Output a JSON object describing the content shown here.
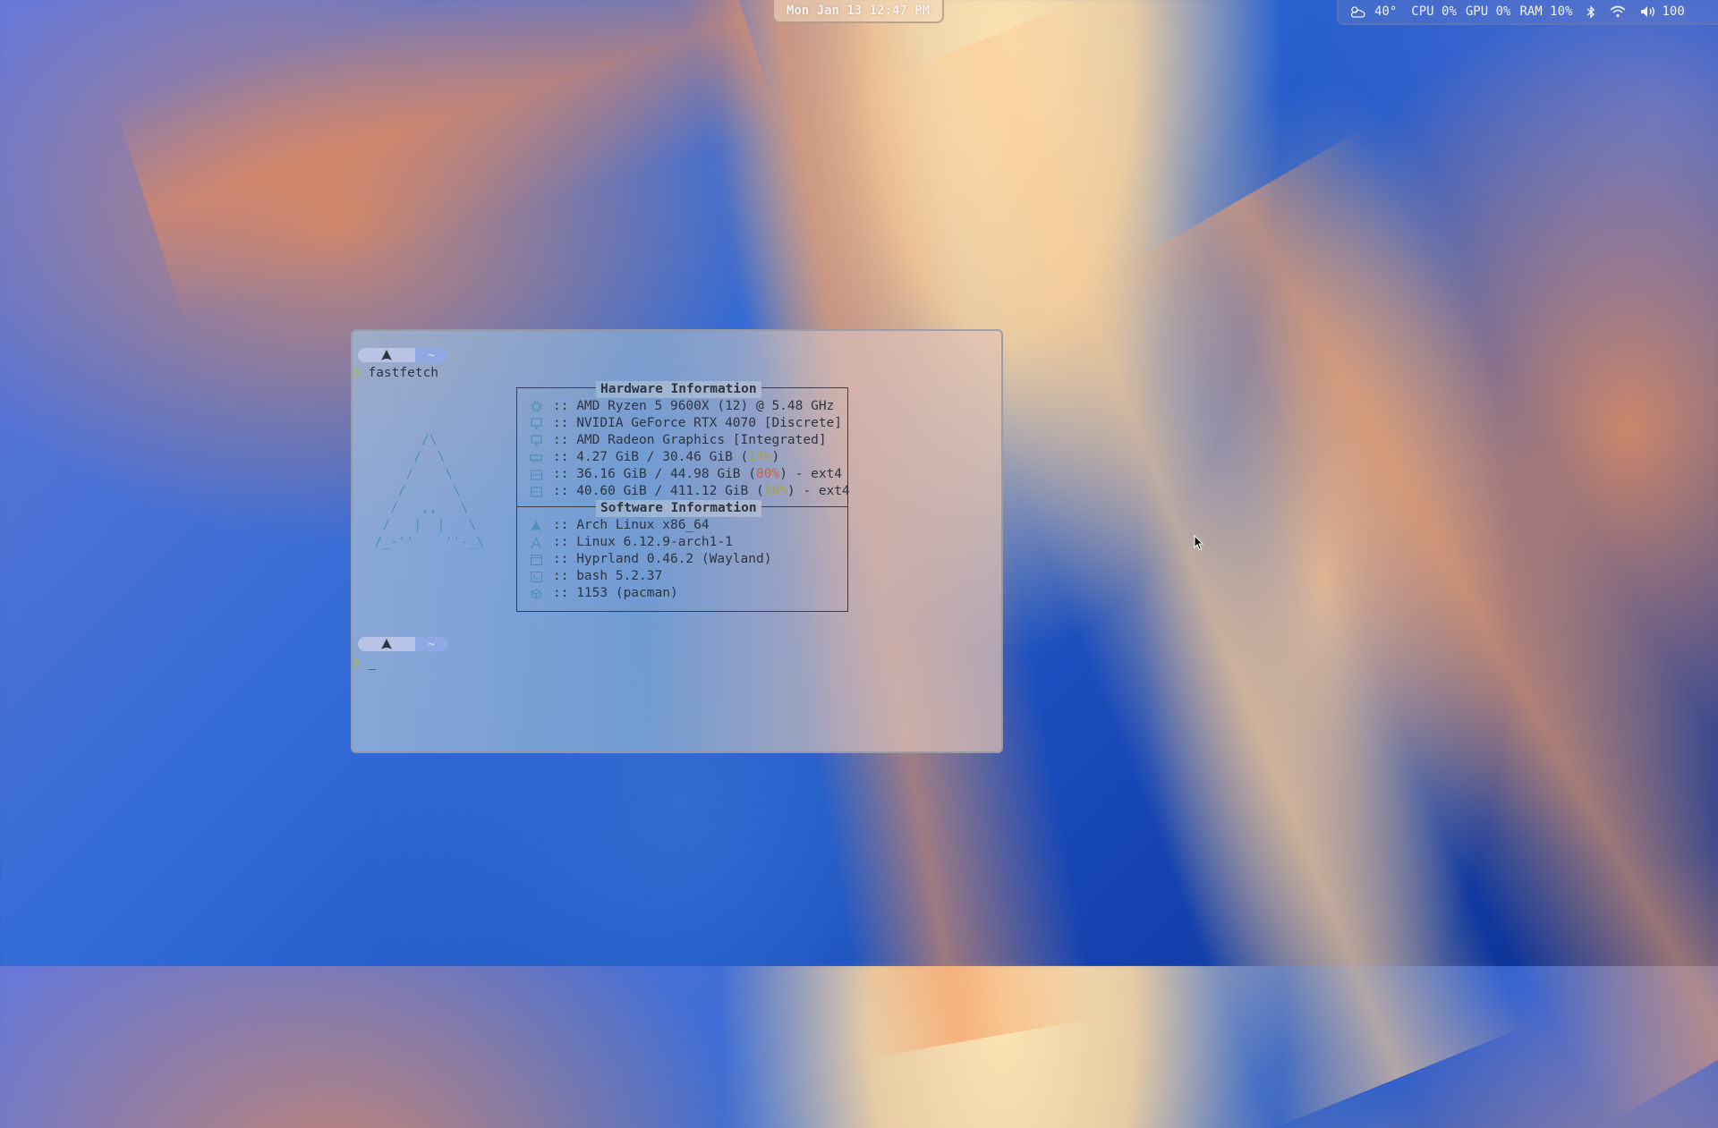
{
  "topbar": {
    "clock": "Mon Jan 13 12:47 PM",
    "weather": "40°",
    "cpu": "CPU 0%",
    "gpu": "GPU 0%",
    "ram": "RAM 10%",
    "volume": "100",
    "icons": [
      "weather-cloud-sun-icon",
      "bluetooth-icon",
      "wifi-icon",
      "volume-icon"
    ]
  },
  "terminal": {
    "prompt_dir": "~",
    "prompt_symbol": "❯",
    "command": "fastfetch",
    "cursor": "_",
    "hardware_title": "Hardware Information",
    "software_title": "Software Information",
    "sep": ":: ",
    "hardware": [
      {
        "icon": "cpu-icon",
        "text": "AMD Ryzen 5 9600X (12) @ 5.48 GHz"
      },
      {
        "icon": "gpu-icon",
        "text": "NVIDIA GeForce RTX 4070 [Discrete]"
      },
      {
        "icon": "gpu-icon",
        "text": "AMD Radeon Graphics [Integrated]"
      },
      {
        "icon": "memory-icon",
        "pre": "4.27 GiB / 30.46 GiB (",
        "pct": "14%",
        "post": ")"
      },
      {
        "icon": "disk-icon",
        "pre": "36.16 GiB / 44.98 GiB (",
        "pct": "80%",
        "post": ") - ext4"
      },
      {
        "icon": "disk-icon",
        "pre": "40.60 GiB / 411.12 GiB (",
        "pct": "10%",
        "post": ") - ext4"
      }
    ],
    "software": [
      {
        "icon": "arch-logo-icon",
        "text": "Arch Linux x86_64"
      },
      {
        "icon": "kernel-icon",
        "text": "Linux 6.12.9-arch1-1"
      },
      {
        "icon": "window-manager-icon",
        "text": "Hyprland 0.46.2 (Wayland)"
      },
      {
        "icon": "terminal-icon",
        "text": "bash 5.2.37"
      },
      {
        "icon": "package-icon",
        "text": "1153 (pacman)"
      }
    ],
    "ascii_logo": "       /\\\n      /  \\\n     /    \\\n    /      \\\n   /   ,,   \\\n  /   |  |   \\\n /_-''    ''-_\\",
    "colors": {
      "accent": "#4e8fb4",
      "green": "#9fb84a",
      "warn_yellow": "#a7a34a",
      "warn_red": "#d4603e"
    }
  }
}
